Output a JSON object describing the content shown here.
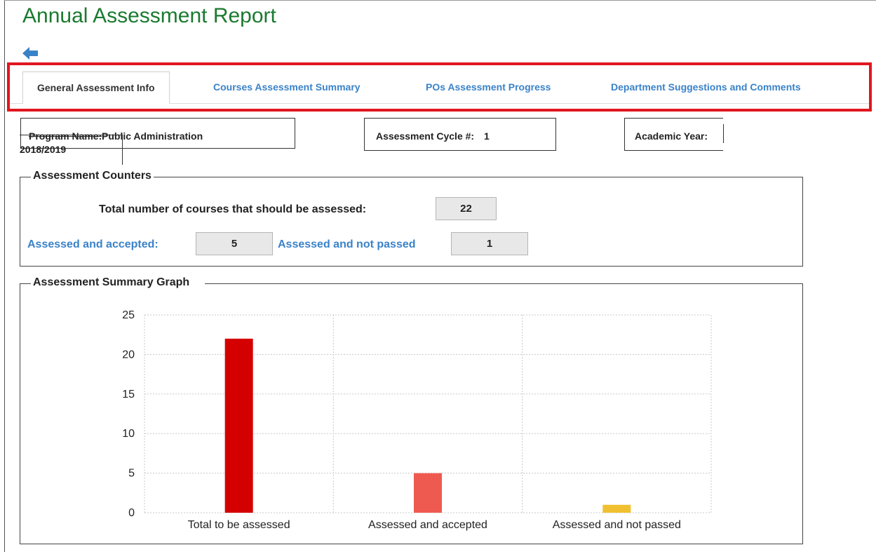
{
  "page": {
    "title": "Annual Assessment Report"
  },
  "tabs": [
    {
      "label": "General Assessment Info",
      "active": true
    },
    {
      "label": "Courses Assessment Summary",
      "active": false
    },
    {
      "label": "POs Assessment Progress",
      "active": false
    },
    {
      "label": "Department Suggestions and Comments",
      "active": false
    }
  ],
  "info": {
    "program_label": "Program Name:",
    "program_value": "Public Administration",
    "year_value": "2018/2019",
    "cycle_label": "Assessment Cycle #:",
    "cycle_value": "1",
    "academic_year_label": "Academic Year:"
  },
  "counters": {
    "legend": "Assessment Counters",
    "total_label": "Total number of courses that should be assessed:",
    "total_value": "22",
    "accepted_label": "Assessed and accepted:",
    "accepted_value": "5",
    "not_passed_label": "Assessed and not passed",
    "not_passed_value": "1"
  },
  "graph": {
    "legend": "Assessment Summary Graph"
  },
  "colors": {
    "title": "#1b7a2f",
    "tab_link": "#3a82c8",
    "highlight_border": "#e0171f",
    "bar_total": "#d40000",
    "bar_accepted": "#ef5a50",
    "bar_not_passed": "#f0c030"
  },
  "chart_data": {
    "type": "bar",
    "categories": [
      "Total to be assessed",
      "Assessed and accepted",
      "Assessed and not passed"
    ],
    "values": [
      22,
      5,
      1
    ],
    "colors": [
      "#d40000",
      "#ef5a50",
      "#f0c030"
    ],
    "ylim": [
      0,
      25
    ],
    "yticks": [
      0,
      5,
      10,
      15,
      20,
      25
    ],
    "grid": true,
    "legend": "none"
  }
}
